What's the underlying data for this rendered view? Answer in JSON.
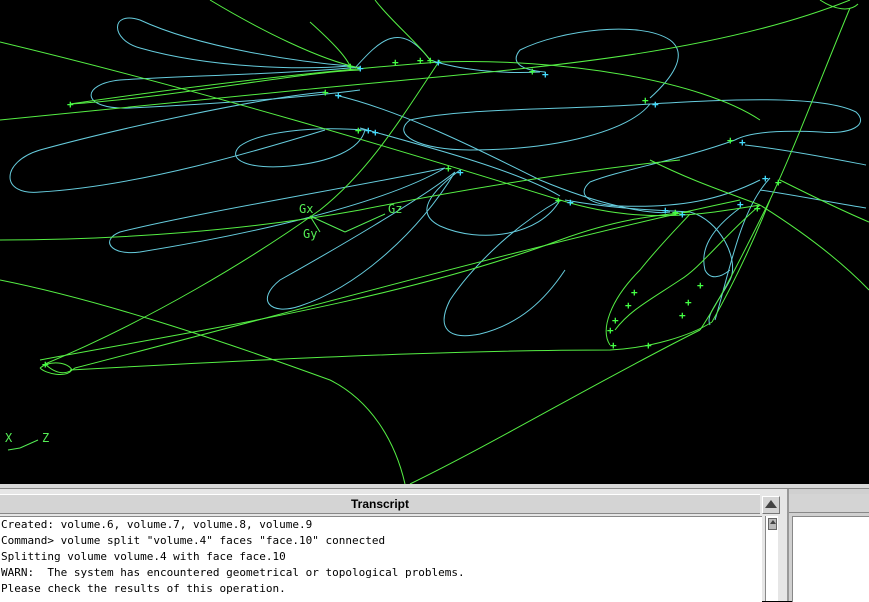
{
  "colors": {
    "wire_green": "#55ee44",
    "wire_cyan": "#66ccdd",
    "vertex_cyan": "#44ddff",
    "vertex_green": "#44ff44"
  },
  "viewport": {
    "gizmo_labels": {
      "gx": "Gx",
      "gz": "Gz",
      "gy": "Gy"
    },
    "axis_triad": {
      "x": "X",
      "z": "Z"
    }
  },
  "transcript": {
    "title": "Transcript",
    "lines": [
      "Created: volume.6, volume.7, volume.8, volume.9",
      "Command> volume split \"volume.4\" faces \"face.10\" connected",
      "Splitting volume volume.4 with face face.10",
      "WARN:  The system has encountered geometrical or topological problems.",
      "Please check the results of this operation."
    ]
  },
  "icons": {
    "scroll_up": "scroll-up-arrow-icon",
    "scroll_thumb": "scroll-thumb-arrow-icon"
  }
}
